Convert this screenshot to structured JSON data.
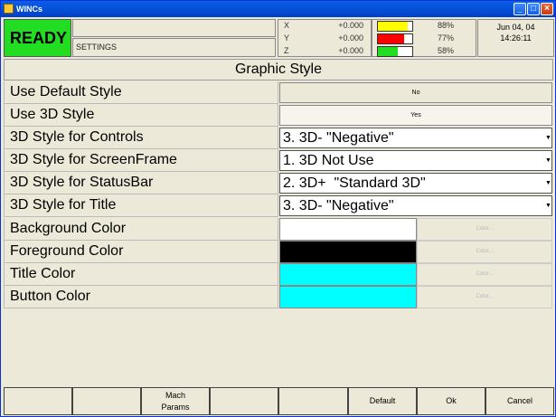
{
  "window": {
    "title": "WINCs",
    "min_icon": "minimize-icon",
    "max_icon": "maximize-icon",
    "close_icon": "close-icon"
  },
  "header": {
    "status": "READY",
    "message_line1": "",
    "message_line2": "SETTINGS",
    "axes": [
      {
        "label": "X",
        "value": "+0.000"
      },
      {
        "label": "Y",
        "value": "+0.000"
      },
      {
        "label": "Z",
        "value": "+0.000"
      }
    ],
    "meters": [
      {
        "percent_text": "88%",
        "level": 0.88,
        "color": "#ffff00"
      },
      {
        "percent_text": "77%",
        "level": 0.77,
        "color": "#ff0000"
      },
      {
        "percent_text": "58%",
        "level": 0.58,
        "color": "#22dd22"
      }
    ],
    "date": "Jun 04, 04",
    "time": "14:26:11"
  },
  "panel": {
    "title": "Graphic Style",
    "rows": [
      {
        "label": "Use Default Style",
        "value": "No"
      },
      {
        "label": "Use 3D Style",
        "value": "Yes"
      },
      {
        "label": "3D Style for Controls",
        "value": "3. 3D- \"Negative\""
      },
      {
        "label": "3D Style for ScreenFrame",
        "value": "1. 3D Not Use"
      },
      {
        "label": "3D Style for StatusBar",
        "value": "2. 3D+  \"Standard 3D\""
      },
      {
        "label": "3D Style for Title",
        "value": "3. 3D- \"Negative\""
      },
      {
        "label": "Background Color",
        "color": "#ffffff",
        "button": "Color..."
      },
      {
        "label": "Foreground Color",
        "color": "#000000",
        "button": "Color..."
      },
      {
        "label": "Title Color",
        "color": "#00ffff",
        "button": "Color..."
      },
      {
        "label": "Button Color",
        "color": "#00ffff",
        "button": "Color..."
      }
    ]
  },
  "function_keys": [
    {
      "line1": "",
      "line2": ""
    },
    {
      "line1": "",
      "line2": ""
    },
    {
      "line1": "Mach",
      "line2": "Params"
    },
    {
      "line1": "",
      "line2": ""
    },
    {
      "line1": "",
      "line2": ""
    },
    {
      "line1": "Default",
      "line2": ""
    },
    {
      "line1": "Ok",
      "line2": ""
    },
    {
      "line1": "Cancel",
      "line2": ""
    }
  ]
}
